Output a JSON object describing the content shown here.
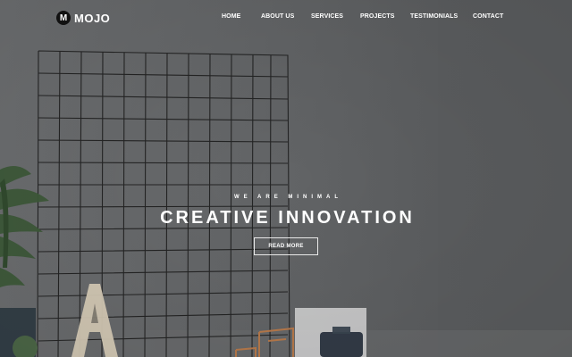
{
  "brand": {
    "mark": "M",
    "name": "MOJO"
  },
  "nav": {
    "home": "HOME",
    "about": "ABOUT US",
    "services": "SERVICES",
    "projects": "PROJECTS",
    "testimonials": "TESTIMONIALS",
    "contact": "CONTACT"
  },
  "hero": {
    "tagline": "WE ARE MINIMAL",
    "headline": "CREATIVE INNOVATION",
    "button": "READ MORE"
  }
}
